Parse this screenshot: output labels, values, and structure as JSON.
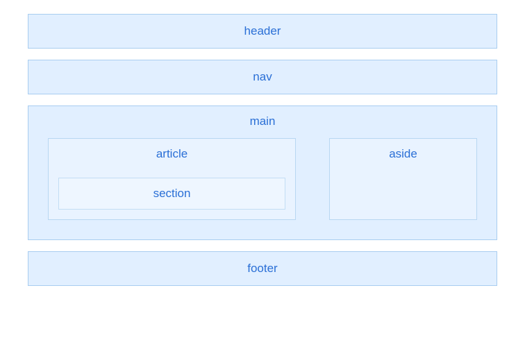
{
  "layout": {
    "header": "header",
    "nav": "nav",
    "main": "main",
    "article": "article",
    "section": "section",
    "aside": "aside",
    "footer": "footer"
  },
  "colors": {
    "box_bg": "#e1efff",
    "box_border": "#a8cdf0",
    "nested_bg": "#e9f3ff",
    "nested_border": "#b8d7f2",
    "deep_bg": "#eef6ff",
    "deep_border": "#c2ddf4",
    "text": "#2a6fd6"
  }
}
